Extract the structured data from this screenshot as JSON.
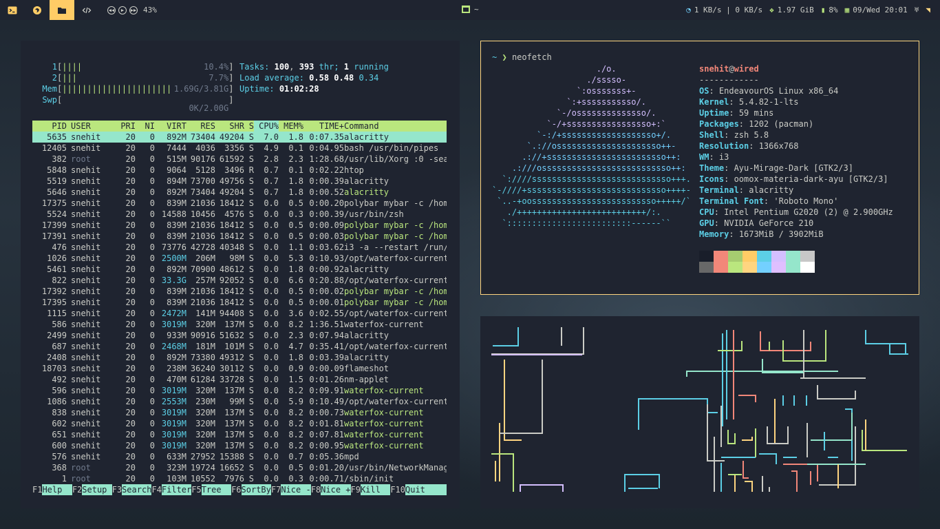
{
  "topbar": {
    "volume": "43%",
    "window_title": "~",
    "net": "1 KB/s | 0 KB/s",
    "memory": "1.97 GiB",
    "battery": "8%",
    "date": "09/Wed 20:01",
    "colors": {
      "bg": "#1f2430",
      "accent": "#ffcc66"
    }
  },
  "htop": {
    "cpu1": {
      "label": "1",
      "bar": "||||",
      "value": "10.4%"
    },
    "cpu2": {
      "label": "2",
      "bar": "|||",
      "value": "7.7%"
    },
    "mem": {
      "label": "Mem",
      "bar": "||||||||||||||||||||||",
      "value": "1.69G/3.81G"
    },
    "swp": {
      "label": "Swp",
      "bar": "",
      "value": "0K/2.00G"
    },
    "tasks_label": "Tasks:",
    "tasks": "100",
    "thr": "393",
    "thr_label": "thr;",
    "running": "1",
    "running_label": "running",
    "load_label": "Load average:",
    "load1": "0.58",
    "load5": "0.48",
    "load15": "0.34",
    "uptime_label": "Uptime:",
    "uptime": "01:02:28",
    "columns": [
      "PID",
      "USER",
      "PRI",
      "NI",
      "VIRT",
      "RES",
      "SHR",
      "S",
      "CPU%",
      "MEM%",
      "TIME+",
      "Command"
    ],
    "rows": [
      [
        "5635",
        "snehit",
        "20",
        "0",
        "892M",
        "73404",
        "49204",
        "S",
        "7.0",
        "1.8",
        "0:07.35",
        "alacritty"
      ],
      [
        "12405",
        "snehit",
        "20",
        "0",
        "7444",
        "4036",
        "3356",
        "S",
        "4.9",
        "0.1",
        "0:04.95",
        "bash /usr/bin/pipes"
      ],
      [
        "382",
        "root",
        "20",
        "0",
        "515M",
        "90176",
        "61592",
        "S",
        "2.8",
        "2.3",
        "1:28.68",
        "/usr/lib/Xorg :0 -sea"
      ],
      [
        "5848",
        "snehit",
        "20",
        "0",
        "9064",
        "5128",
        "3496",
        "R",
        "0.7",
        "0.1",
        "0:02.22",
        "htop"
      ],
      [
        "5519",
        "snehit",
        "20",
        "0",
        "894M",
        "73700",
        "49756",
        "S",
        "0.7",
        "1.8",
        "0:00.39",
        "alacritty"
      ],
      [
        "5646",
        "snehit",
        "20",
        "0",
        "892M",
        "73404",
        "49204",
        "S",
        "0.7",
        "1.8",
        "0:00.52",
        "alacritty"
      ],
      [
        "17375",
        "snehit",
        "20",
        "0",
        "839M",
        "21036",
        "18412",
        "S",
        "0.0",
        "0.5",
        "0:00.20",
        "polybar mybar -c /hom"
      ],
      [
        "5524",
        "snehit",
        "20",
        "0",
        "14588",
        "10456",
        "4576",
        "S",
        "0.0",
        "0.3",
        "0:00.39",
        "/usr/bin/zsh"
      ],
      [
        "17399",
        "snehit",
        "20",
        "0",
        "839M",
        "21036",
        "18412",
        "S",
        "0.0",
        "0.5",
        "0:00.09",
        "polybar mybar -c /hom"
      ],
      [
        "17391",
        "snehit",
        "20",
        "0",
        "839M",
        "21036",
        "18412",
        "S",
        "0.0",
        "0.5",
        "0:00.03",
        "polybar mybar -c /hom"
      ],
      [
        "476",
        "snehit",
        "20",
        "0",
        "73776",
        "42728",
        "40348",
        "S",
        "0.0",
        "1.1",
        "0:03.62",
        "i3 -a --restart /run/"
      ],
      [
        "1026",
        "snehit",
        "20",
        "0",
        "2500M",
        "206M",
        "98M",
        "S",
        "0.0",
        "5.3",
        "0:10.93",
        "/opt/waterfox-current"
      ],
      [
        "5461",
        "snehit",
        "20",
        "0",
        "892M",
        "70900",
        "48612",
        "S",
        "0.0",
        "1.8",
        "0:00.92",
        "alacritty"
      ],
      [
        "822",
        "snehit",
        "20",
        "0",
        "33.3G",
        "257M",
        "92052",
        "S",
        "0.0",
        "6.6",
        "0:20.88",
        "/opt/waterfox-current"
      ],
      [
        "17392",
        "snehit",
        "20",
        "0",
        "839M",
        "21036",
        "18412",
        "S",
        "0.0",
        "0.5",
        "0:00.02",
        "polybar mybar -c /hom"
      ],
      [
        "17395",
        "snehit",
        "20",
        "0",
        "839M",
        "21036",
        "18412",
        "S",
        "0.0",
        "0.5",
        "0:00.01",
        "polybar mybar -c /hom"
      ],
      [
        "1115",
        "snehit",
        "20",
        "0",
        "2472M",
        "141M",
        "94408",
        "S",
        "0.0",
        "3.6",
        "0:02.55",
        "/opt/waterfox-current"
      ],
      [
        "586",
        "snehit",
        "20",
        "0",
        "3019M",
        "320M",
        "137M",
        "S",
        "0.0",
        "8.2",
        "1:36.51",
        "waterfox-current"
      ],
      [
        "2499",
        "snehit",
        "20",
        "0",
        "933M",
        "90916",
        "51632",
        "S",
        "0.0",
        "2.3",
        "0:07.94",
        "alacritty"
      ],
      [
        "687",
        "snehit",
        "20",
        "0",
        "2468M",
        "181M",
        "101M",
        "S",
        "0.0",
        "4.7",
        "0:35.41",
        "/opt/waterfox-current"
      ],
      [
        "2408",
        "snehit",
        "20",
        "0",
        "892M",
        "73380",
        "49312",
        "S",
        "0.0",
        "1.8",
        "0:03.39",
        "alacritty"
      ],
      [
        "18703",
        "snehit",
        "20",
        "0",
        "238M",
        "36240",
        "30112",
        "S",
        "0.0",
        "0.9",
        "0:00.09",
        "flameshot"
      ],
      [
        "492",
        "snehit",
        "20",
        "0",
        "470M",
        "61284",
        "33728",
        "S",
        "0.0",
        "1.5",
        "0:01.26",
        "nm-applet"
      ],
      [
        "596",
        "snehit",
        "20",
        "0",
        "3019M",
        "320M",
        "137M",
        "S",
        "0.0",
        "8.2",
        "0:09.91",
        "waterfox-current"
      ],
      [
        "1086",
        "snehit",
        "20",
        "0",
        "2553M",
        "230M",
        "99M",
        "S",
        "0.0",
        "5.9",
        "0:10.49",
        "/opt/waterfox-current"
      ],
      [
        "838",
        "snehit",
        "20",
        "0",
        "3019M",
        "320M",
        "137M",
        "S",
        "0.0",
        "8.2",
        "0:00.73",
        "waterfox-current"
      ],
      [
        "602",
        "snehit",
        "20",
        "0",
        "3019M",
        "320M",
        "137M",
        "S",
        "0.0",
        "8.2",
        "0:01.81",
        "waterfox-current"
      ],
      [
        "651",
        "snehit",
        "20",
        "0",
        "3019M",
        "320M",
        "137M",
        "S",
        "0.0",
        "8.2",
        "0:07.81",
        "waterfox-current"
      ],
      [
        "600",
        "snehit",
        "20",
        "0",
        "3019M",
        "320M",
        "137M",
        "S",
        "0.0",
        "8.2",
        "0:00.95",
        "waterfox-current"
      ],
      [
        "576",
        "snehit",
        "20",
        "0",
        "633M",
        "27952",
        "15388",
        "S",
        "0.0",
        "0.7",
        "0:05.36",
        "mpd"
      ],
      [
        "368",
        "root",
        "20",
        "0",
        "323M",
        "19724",
        "16652",
        "S",
        "0.0",
        "0.5",
        "0:01.20",
        "/usr/bin/NetworkManag"
      ],
      [
        "1",
        "root",
        "20",
        "0",
        "103M",
        "10552",
        "7976",
        "S",
        "0.0",
        "0.3",
        "0:00.71",
        "/sbin/init"
      ]
    ],
    "thread_rows": [
      5,
      8,
      9,
      14,
      15,
      23,
      25,
      26,
      27,
      28
    ],
    "footer": [
      {
        "key": "F1",
        "label": "Help  "
      },
      {
        "key": "F2",
        "label": "Setup "
      },
      {
        "key": "F3",
        "label": "Search"
      },
      {
        "key": "F4",
        "label": "Filter"
      },
      {
        "key": "F5",
        "label": "Tree  "
      },
      {
        "key": "F6",
        "label": "SortBy"
      },
      {
        "key": "F7",
        "label": "Nice -"
      },
      {
        "key": "F8",
        "label": "Nice +"
      },
      {
        "key": "F9",
        "label": "Kill  "
      },
      {
        "key": "F10",
        "label": "Quit"
      }
    ]
  },
  "neofetch": {
    "prompt_dir": "~",
    "prompt_arrow": "❯",
    "command": "neofetch",
    "user": "snehit",
    "at": "@",
    "host": "wired",
    "separator": "------------",
    "info": [
      {
        "key": "OS",
        "value": "EndeavourOS Linux x86_64"
      },
      {
        "key": "Kernel",
        "value": "5.4.82-1-lts"
      },
      {
        "key": "Uptime",
        "value": "59 mins"
      },
      {
        "key": "Packages",
        "value": "1202 (pacman)"
      },
      {
        "key": "Shell",
        "value": "zsh 5.8"
      },
      {
        "key": "Resolution",
        "value": "1366x768"
      },
      {
        "key": "WM",
        "value": "i3"
      },
      {
        "key": "Theme",
        "value": "Ayu-Mirage-Dark [GTK2/3]"
      },
      {
        "key": "Icons",
        "value": "oomox-materia-dark-ayu [GTK2/3]"
      },
      {
        "key": "Terminal",
        "value": "alacritty"
      },
      {
        "key": "Terminal Font",
        "value": "'Roboto Mono'"
      },
      {
        "key": "CPU",
        "value": "Intel Pentium G2020 (2) @ 2.900GHz"
      },
      {
        "key": "GPU",
        "value": "NVIDIA GeForce 210"
      },
      {
        "key": "Memory",
        "value": "1673MiB / 3902MiB"
      }
    ],
    "ascii": [
      "                     ./o.",
      "                   ./sssso-",
      "                 `:osssssss+-",
      "               `:+sssssssssso/.",
      "             `-/ossssssssssssso/.",
      "           `-/+sssssssssssssssso+:`",
      "         `-:/+sssssssssssssssssso+/.",
      "       `.://osssssssssssssssssssso++-",
      "      .://+ssssssssssssssssssssssso++:",
      "    .:///ossssssssssssssssssssssssso++:",
      "  `:////ssssssssssssssssssssssssssso+++.",
      "`-////+ssssssssssssssssssssssssssso++++-",
      " `..-+oosssssssssssssssssssssssso+++++/`",
      "   ./++++++++++++++++++++++++++/:.",
      "  `:::::::::::::::::::::::::------``"
    ],
    "palette_top": [
      "#191e2a",
      "#f28779",
      "#a6cc70",
      "#ffcc66",
      "#5ccfe6",
      "#d4bfff",
      "#95e6cb",
      "#c7c7c7"
    ],
    "palette_bottom": [
      "#686868",
      "#f28779",
      "#bae67e",
      "#ffd580",
      "#73d0ff",
      "#dfbfff",
      "#95e6cb",
      "#ffffff"
    ]
  },
  "pipes": {
    "colors": [
      "#ffd580",
      "#5ccfe6",
      "#f28779",
      "#bae67e",
      "#cbccc6",
      "#d4bfff",
      "#95e6cb"
    ]
  }
}
